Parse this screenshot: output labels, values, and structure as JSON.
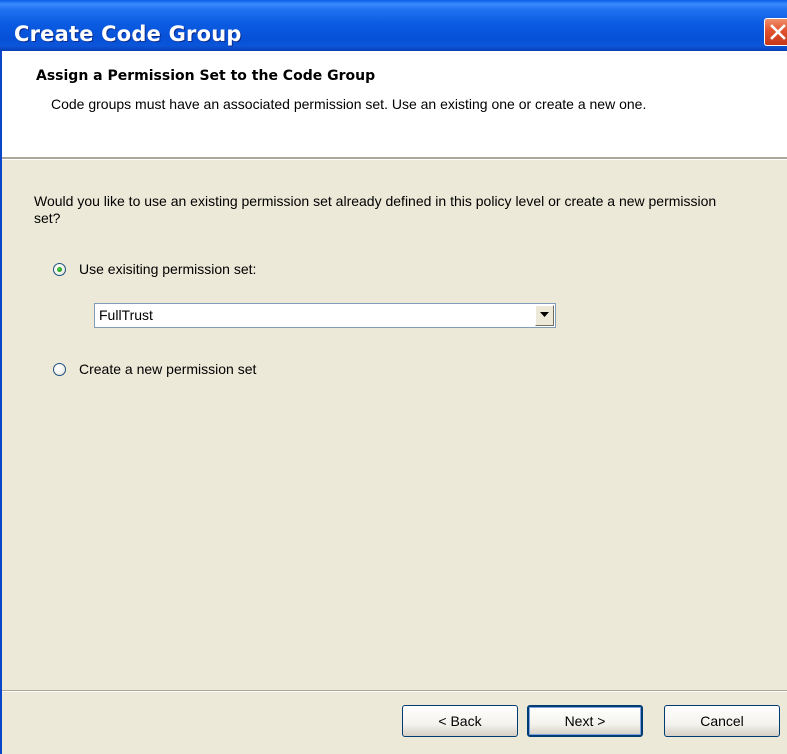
{
  "window": {
    "title": "Create Code Group"
  },
  "header": {
    "title": "Assign a Permission Set to the Code Group",
    "description": "Code groups must have an associated permission set. Use an existing one or create a new one."
  },
  "body": {
    "question": "Would you like to use an existing permission set already defined in this policy level or create a new permission set?",
    "options": [
      {
        "label": "Use exisiting permission set:",
        "checked": true
      },
      {
        "label": "Create a new permission set",
        "checked": false
      }
    ],
    "permission_set_select": {
      "selected": "FullTrust"
    }
  },
  "footer": {
    "back_label": "< Back",
    "next_label": "Next >",
    "cancel_label": "Cancel"
  },
  "colors": {
    "titlebar": "#0A5EEA",
    "dialog_face": "#ECE9D8",
    "close_button": "#E0522D",
    "radio_dot": "#21A121"
  }
}
